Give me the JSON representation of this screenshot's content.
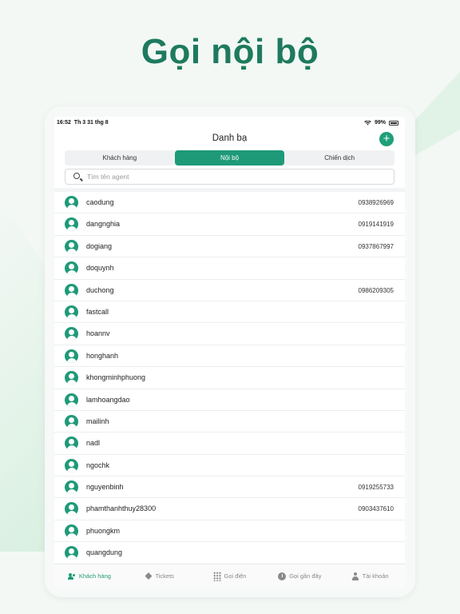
{
  "hero": {
    "title": "Gọi nội bộ"
  },
  "status_bar": {
    "time": "16:52",
    "date": "Th 3 31 thg 8",
    "battery": "99%"
  },
  "header": {
    "title": "Danh bạ",
    "add_icon": "plus-icon"
  },
  "segments": [
    {
      "label": "Khách hàng",
      "active": false
    },
    {
      "label": "Nội bộ",
      "active": true
    },
    {
      "label": "Chiến dịch",
      "active": false
    }
  ],
  "search": {
    "placeholder": "Tìm tên agent",
    "value": ""
  },
  "contacts": [
    {
      "name": "caodung",
      "phone": "0938926969"
    },
    {
      "name": "dangnghia",
      "phone": "0919141919"
    },
    {
      "name": "dogiang",
      "phone": "0937867997"
    },
    {
      "name": "doquynh",
      "phone": ""
    },
    {
      "name": "duchong",
      "phone": "0986209305"
    },
    {
      "name": "fastcall",
      "phone": ""
    },
    {
      "name": "hoannv",
      "phone": ""
    },
    {
      "name": "honghanh",
      "phone": ""
    },
    {
      "name": "khongminhphuong",
      "phone": ""
    },
    {
      "name": "lamhoangdao",
      "phone": ""
    },
    {
      "name": "mailinh",
      "phone": ""
    },
    {
      "name": "nadl",
      "phone": ""
    },
    {
      "name": "ngochk",
      "phone": ""
    },
    {
      "name": "nguyenbinh",
      "phone": "0919255733"
    },
    {
      "name": "phamthanhthuy28300",
      "phone": "0903437610"
    },
    {
      "name": "phuongkm",
      "phone": ""
    },
    {
      "name": "quangdung",
      "phone": ""
    }
  ],
  "tabbar": [
    {
      "label": "Khách hàng",
      "icon": "users-icon",
      "active": true
    },
    {
      "label": "Tickets",
      "icon": "ticket-icon",
      "active": false
    },
    {
      "label": "Gọi điện",
      "icon": "dialpad-icon",
      "active": false
    },
    {
      "label": "Gọi gần đây",
      "icon": "clock-icon",
      "active": false
    },
    {
      "label": "Tài khoản",
      "icon": "person-icon",
      "active": false
    }
  ],
  "colors": {
    "accent": "#1e9a78",
    "hero_text": "#1e7a5e"
  }
}
